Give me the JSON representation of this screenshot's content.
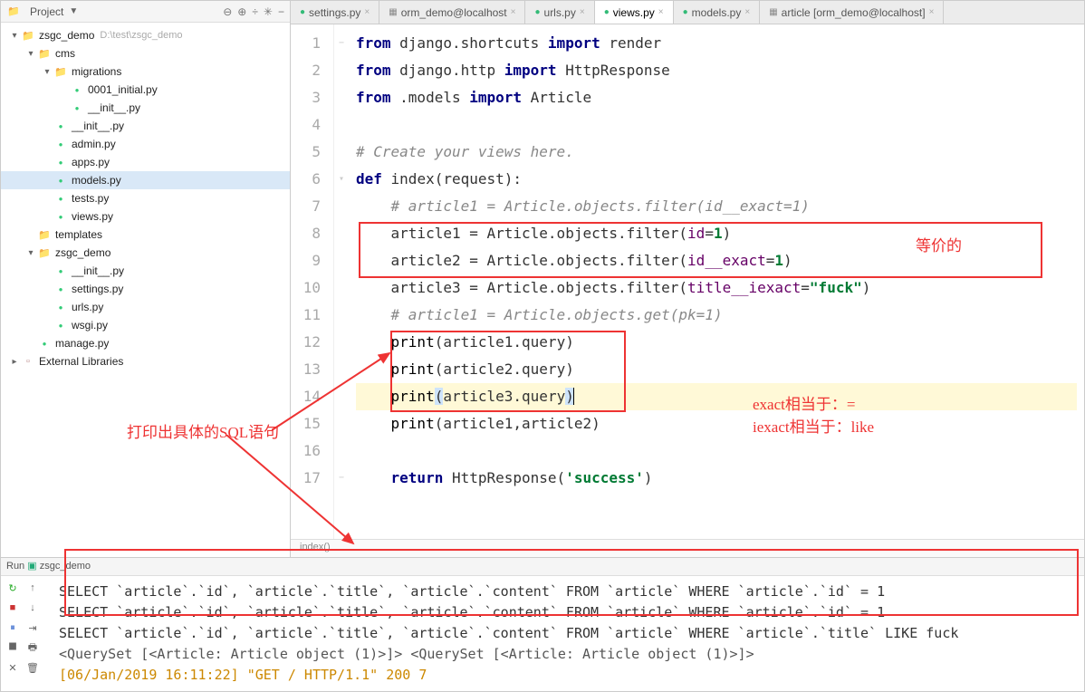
{
  "sidebar": {
    "title": "Project",
    "root": {
      "name": "zsgc_demo",
      "path": "D:\\test\\zsgc_demo"
    },
    "tree": [
      {
        "depth": 0,
        "toggle": "▾",
        "icon": "folder",
        "label": "zsgc_demo",
        "path": "D:\\test\\zsgc_demo"
      },
      {
        "depth": 1,
        "toggle": "▾",
        "icon": "folder",
        "label": "cms"
      },
      {
        "depth": 2,
        "toggle": "▾",
        "icon": "folder",
        "label": "migrations"
      },
      {
        "depth": 3,
        "toggle": "",
        "icon": "py",
        "label": "0001_initial.py"
      },
      {
        "depth": 3,
        "toggle": "",
        "icon": "py",
        "label": "__init__.py"
      },
      {
        "depth": 2,
        "toggle": "",
        "icon": "py",
        "label": "__init__.py"
      },
      {
        "depth": 2,
        "toggle": "",
        "icon": "py",
        "label": "admin.py"
      },
      {
        "depth": 2,
        "toggle": "",
        "icon": "py",
        "label": "apps.py"
      },
      {
        "depth": 2,
        "toggle": "",
        "icon": "py",
        "label": "models.py",
        "selected": true
      },
      {
        "depth": 2,
        "toggle": "",
        "icon": "py",
        "label": "tests.py"
      },
      {
        "depth": 2,
        "toggle": "",
        "icon": "py",
        "label": "views.py"
      },
      {
        "depth": 1,
        "toggle": "",
        "icon": "folder",
        "label": "templates"
      },
      {
        "depth": 1,
        "toggle": "▾",
        "icon": "folder",
        "label": "zsgc_demo"
      },
      {
        "depth": 2,
        "toggle": "",
        "icon": "py",
        "label": "__init__.py"
      },
      {
        "depth": 2,
        "toggle": "",
        "icon": "py",
        "label": "settings.py"
      },
      {
        "depth": 2,
        "toggle": "",
        "icon": "py",
        "label": "urls.py"
      },
      {
        "depth": 2,
        "toggle": "",
        "icon": "py",
        "label": "wsgi.py"
      },
      {
        "depth": 1,
        "toggle": "",
        "icon": "py",
        "label": "manage.py"
      },
      {
        "depth": 0,
        "toggle": "▸",
        "icon": "lib",
        "label": "External Libraries"
      }
    ]
  },
  "tabs": [
    {
      "icon": "py",
      "label": "settings.py"
    },
    {
      "icon": "db",
      "label": "orm_demo@localhost"
    },
    {
      "icon": "py",
      "label": "urls.py"
    },
    {
      "icon": "py",
      "label": "views.py",
      "active": true
    },
    {
      "icon": "py",
      "label": "models.py"
    },
    {
      "icon": "db",
      "label": "article [orm_demo@localhost]"
    }
  ],
  "code": {
    "lines": [
      {
        "n": 1,
        "html": "<span class='kw'>from</span> django.shortcuts <span class='kw'>import</span> render"
      },
      {
        "n": 2,
        "html": "<span class='kw'>from</span> django.http <span class='kw'>import</span> HttpResponse"
      },
      {
        "n": 3,
        "html": "<span class='kw'>from</span> .models <span class='kw'>import</span> Article"
      },
      {
        "n": 4,
        "html": ""
      },
      {
        "n": 5,
        "html": "<span class='cm'># Create your views here.</span>"
      },
      {
        "n": 6,
        "html": "<span class='kw'>def</span> index(request):"
      },
      {
        "n": 7,
        "html": "    <span class='cm'># article1 = Article.objects.filter(id__exact=1)</span>"
      },
      {
        "n": 8,
        "html": "    article1 = Article.objects.filter(<span class='at'>id</span>=<span class='str'>1</span>)"
      },
      {
        "n": 9,
        "html": "    article2 = Article.objects.filter(<span class='at'>id__exact</span>=<span class='str'>1</span>)"
      },
      {
        "n": 10,
        "html": "    article3 = Article.objects.filter(<span class='at'>title__iexact</span>=<span class='str'>\"fuck\"</span>)"
      },
      {
        "n": 11,
        "html": "    <span class='cm'># article1 = Article.objects.get(pk=1)</span>"
      },
      {
        "n": 12,
        "html": "    <span class='fn'>print</span>(article1.query)"
      },
      {
        "n": 13,
        "html": "    <span class='fn'>print</span>(article2.query)"
      },
      {
        "n": 14,
        "html": "    <span class='fn'>print</span><span class='sel-bg'>(</span>article3.query<span class='sel-bg'>)</span><span class='caret'></span>",
        "highlight": true
      },
      {
        "n": 15,
        "html": "    <span class='fn'>print</span>(article1,article2)"
      },
      {
        "n": 16,
        "html": ""
      },
      {
        "n": 17,
        "html": "    <span class='kw'>return</span> HttpResponse(<span class='str'>'success'</span>)"
      }
    ],
    "crumb": "index()"
  },
  "annotations": {
    "equiv": "等价的",
    "printSql": "打印出具体的SQL语句",
    "exactNote": "exact相当于：=",
    "iexactNote": "iexact相当于：like"
  },
  "run": {
    "header": "Run",
    "config": "zsgc_demo",
    "lines": [
      {
        "cls": "sql",
        "text": "SELECT `article`.`id`, `article`.`title`, `article`.`content` FROM `article` WHERE `article`.`id` = 1"
      },
      {
        "cls": "sql",
        "text": "SELECT `article`.`id`, `article`.`title`, `article`.`content` FROM `article` WHERE `article`.`id` = 1"
      },
      {
        "cls": "sql",
        "text": "SELECT `article`.`id`, `article`.`title`, `article`.`content` FROM `article` WHERE `article`.`title` LIKE fuck"
      },
      {
        "cls": "qs",
        "text": "<QuerySet [<Article: Article object (1)>]> <QuerySet [<Article: Article object (1)>]>"
      },
      {
        "cls": "log",
        "text": "[06/Jan/2019 16:11:22] \"GET / HTTP/1.1\" 200 7"
      }
    ]
  }
}
